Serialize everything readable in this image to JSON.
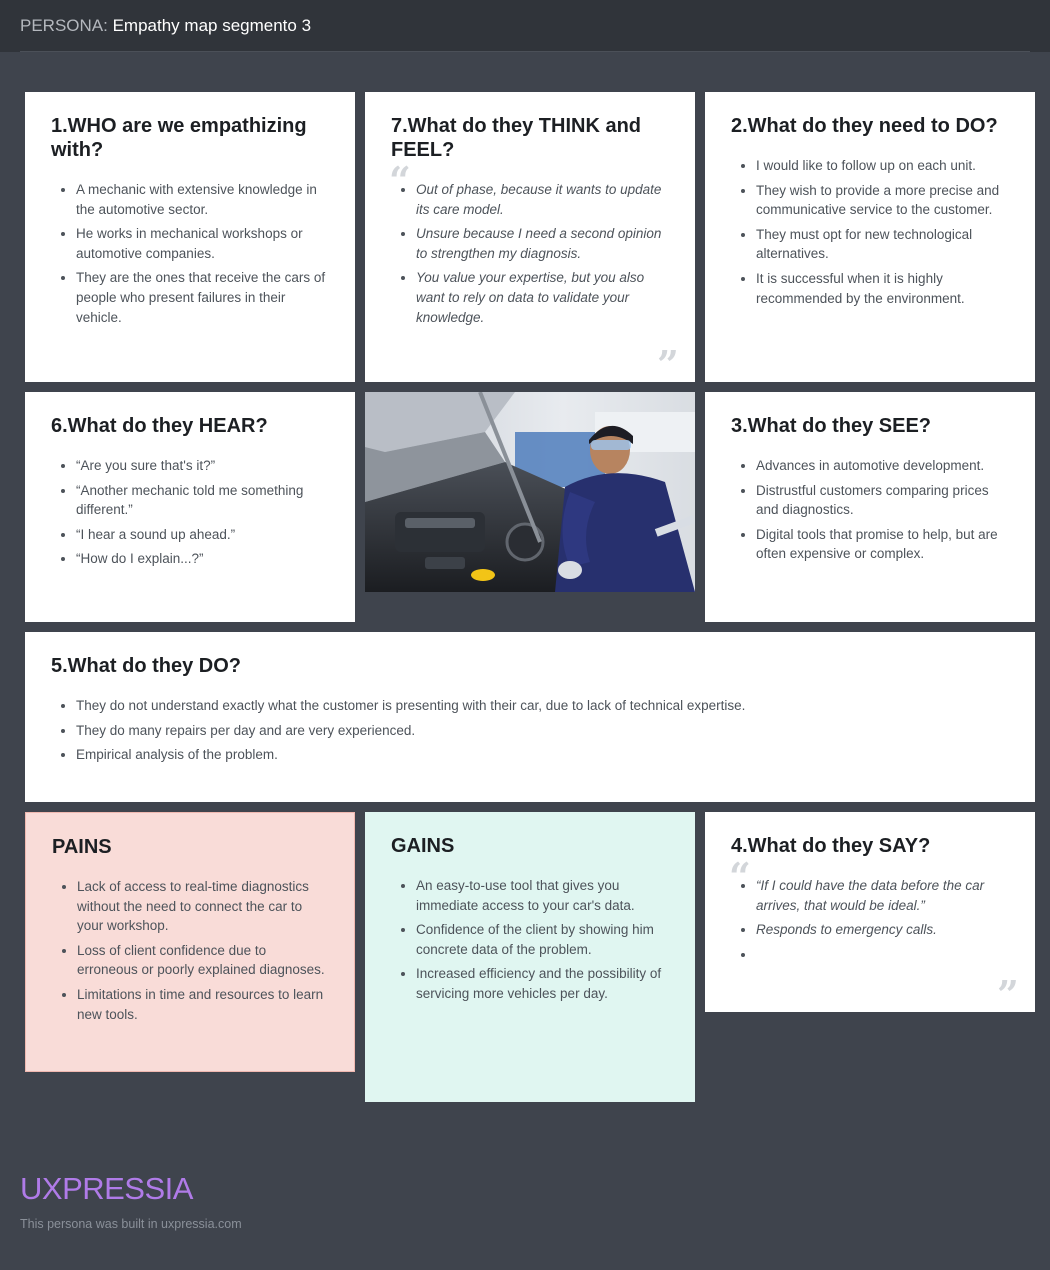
{
  "header": {
    "prefix": "PERSONA:",
    "title": "Empathy map segmento 3"
  },
  "who": {
    "title": "1.WHO are we empathizing with?",
    "items": [
      "A mechanic with extensive knowledge in the automotive sector.",
      "He works in mechanical workshops or automotive companies.",
      "They are the ones that receive the cars of people who present failures in their vehicle."
    ]
  },
  "think": {
    "title": "7.What do they THINK and FEEL?",
    "items": [
      "Out of phase, because it wants to update its care model.",
      "Unsure because I need a second opinion to strengthen my diagnosis.",
      "You value your expertise, but you also want to rely on data to validate your knowledge."
    ]
  },
  "need": {
    "title": "2.What do they need to DO?",
    "items": [
      "I would like to follow up on each unit.",
      "They wish to provide a more precise and communicative service to the customer.",
      "They must opt for new technological alternatives.",
      "It is successful when it is highly recommended by the environment."
    ]
  },
  "hear": {
    "title": "6.What do they HEAR?",
    "items": [
      "“Are you sure that's it?”",
      "“Another mechanic told me something different.”",
      "“I hear a sound up ahead.”",
      "“How do I explain...?”"
    ]
  },
  "see": {
    "title": "3.What do they SEE?",
    "items": [
      "Advances in automotive development.",
      "Distrustful customers comparing prices and diagnostics.",
      "Digital tools that promise to help, but are often expensive or complex."
    ]
  },
  "do": {
    "title": "5.What do they DO?",
    "items": [
      "They do not understand exactly what the customer is presenting with their car, due to lack of technical expertise.",
      "They do many repairs per day and are very experienced.",
      "Empirical analysis of the problem."
    ]
  },
  "pains": {
    "title": "PAINS",
    "items": [
      "Lack of access to real-time diagnostics without the need to connect the car to your workshop.",
      "Loss of client confidence due to erroneous or poorly explained diagnoses.",
      "Limitations in time and resources to learn new tools."
    ]
  },
  "gains": {
    "title": "GAINS",
    "items": [
      "An easy-to-use tool that gives you immediate access to your car's data.",
      "Confidence of the client by showing him concrete data of the problem.",
      "Increased efficiency and the possibility of servicing more vehicles per day."
    ]
  },
  "say": {
    "title": "4.What do they SAY?",
    "items": [
      "“If I could have the data before the car arrives, that would be ideal.”",
      "Responds to emergency calls.",
      ""
    ]
  },
  "quote_marks": {
    "open": "“",
    "close": "”"
  },
  "footer": {
    "brand": "UXPRESSIA",
    "note": "This persona was built in uxpressia.com"
  },
  "colors": {
    "background": "#3f444d",
    "pains_bg": "#f9dcd8",
    "gains_bg": "#e0f6f1",
    "brand": "#b07be8"
  },
  "icons": [
    "open-quote-icon",
    "close-quote-icon"
  ]
}
